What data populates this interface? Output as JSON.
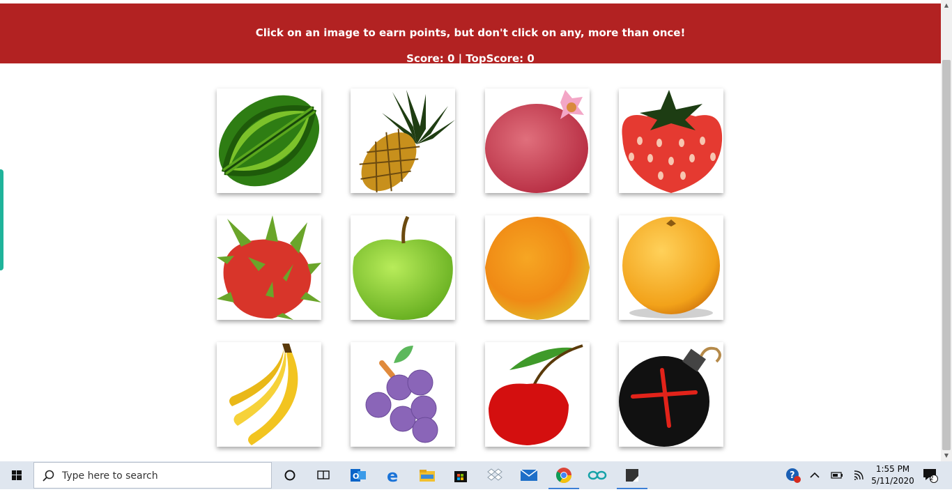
{
  "header": {
    "instructions": "Click on an image to earn points, but don't click on any, more than once!",
    "score_text": "Score: 0 | TopScore: 0"
  },
  "cards": [
    {
      "name": "watermelon"
    },
    {
      "name": "pineapple"
    },
    {
      "name": "pomegranate"
    },
    {
      "name": "strawberry"
    },
    {
      "name": "dragon-fruit"
    },
    {
      "name": "green-apple"
    },
    {
      "name": "orange"
    },
    {
      "name": "grapefruit"
    },
    {
      "name": "banana"
    },
    {
      "name": "grapes"
    },
    {
      "name": "cherry"
    },
    {
      "name": "bomb"
    }
  ],
  "taskbar": {
    "search_placeholder": "Type here to search",
    "time": "1:55 PM",
    "date": "5/11/2020",
    "notification_count": "2",
    "pinned_icons": [
      "cortana-icon",
      "task-view-icon",
      "outlook-icon",
      "edge-icon",
      "file-explorer-icon",
      "store-icon",
      "dropbox-icon",
      "mail-icon",
      "chrome-icon",
      "arduino-icon",
      "sticky-notes-icon"
    ]
  },
  "colors": {
    "header_bg": "#b22222",
    "header_text": "#ffffff"
  }
}
